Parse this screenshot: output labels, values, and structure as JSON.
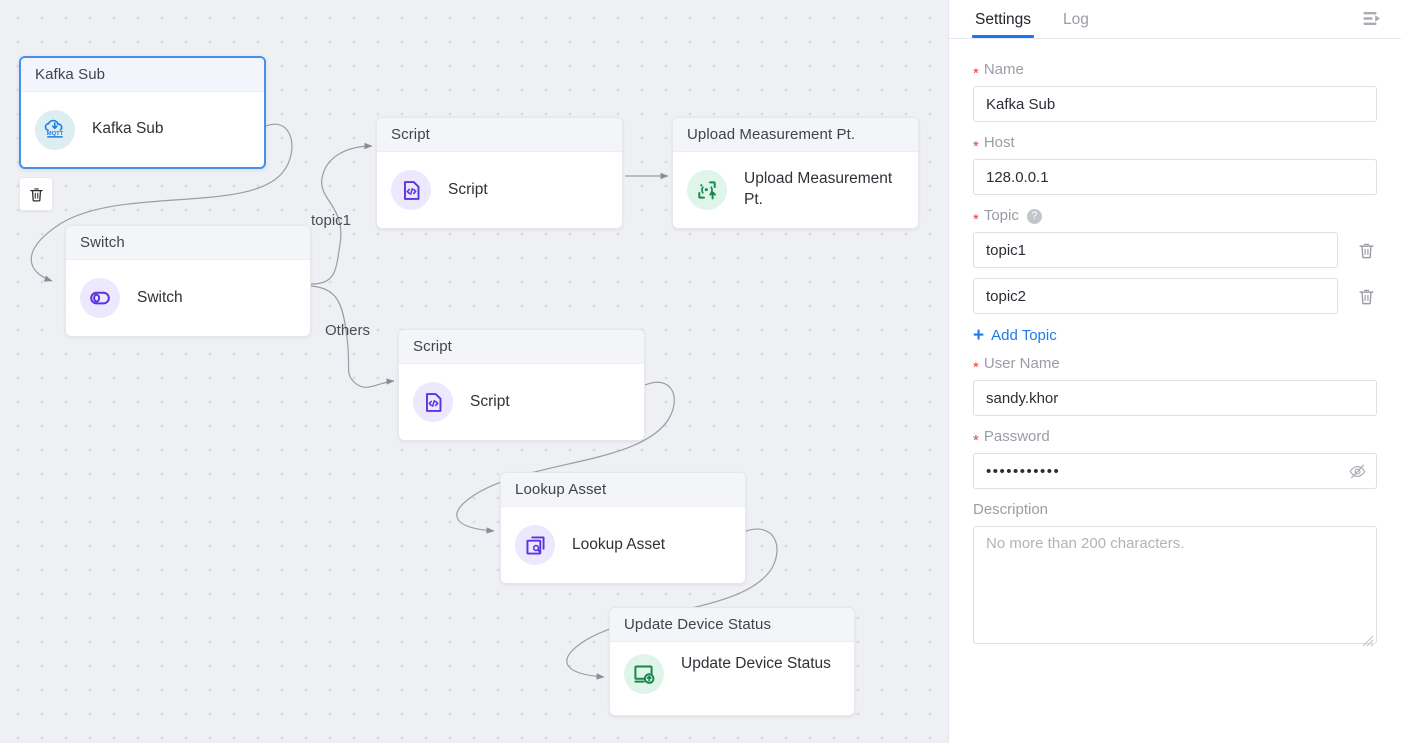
{
  "canvas": {
    "delete_button_icon": "trash-icon",
    "nodes": [
      {
        "id": "kafka-sub",
        "title": "Kafka Sub",
        "label": "Kafka Sub",
        "icon": "mqtt-cloud-icon",
        "selected": true
      },
      {
        "id": "switch",
        "title": "Switch",
        "label": "Switch",
        "icon": "switch-toggle-icon",
        "selected": false
      },
      {
        "id": "script-1",
        "title": "Script",
        "label": "Script",
        "icon": "script-code-icon",
        "selected": false
      },
      {
        "id": "upload-mp",
        "title": "Upload Measurement Pt.",
        "label": "Upload Measurement Pt.",
        "icon": "upload-signal-icon",
        "selected": false
      },
      {
        "id": "script-2",
        "title": "Script",
        "label": "Script",
        "icon": "script-code-icon",
        "selected": false
      },
      {
        "id": "lookup",
        "title": "Lookup Asset",
        "label": "Lookup Asset",
        "icon": "lookup-search-icon",
        "selected": false
      },
      {
        "id": "update-dev",
        "title": "Update Device Status",
        "label": "Update Device Status",
        "icon": "device-status-icon",
        "selected": false
      }
    ],
    "edge_labels": [
      {
        "id": "edge-topic1",
        "text": "topic1"
      },
      {
        "id": "edge-others",
        "text": "Others"
      }
    ]
  },
  "panel": {
    "tabs": [
      {
        "id": "settings",
        "label": "Settings",
        "active": true
      },
      {
        "id": "log",
        "label": "Log",
        "active": false
      }
    ],
    "collapse_icon": "collapse-panel-icon",
    "fields": {
      "name": {
        "label": "Name",
        "required": true,
        "value": "Kafka Sub"
      },
      "host": {
        "label": "Host",
        "required": true,
        "value": "128.0.0.1"
      },
      "topic": {
        "label": "Topic",
        "required": true,
        "help": "?",
        "values": [
          "topic1",
          "topic2"
        ],
        "delete_icon": "trash-icon",
        "add_label": "Add Topic",
        "add_icon": "plus-icon"
      },
      "user_name": {
        "label": "User Name",
        "required": true,
        "value": "sandy.khor"
      },
      "password": {
        "label": "Password",
        "required": true,
        "value": "•••••••••••",
        "toggle_icon": "eye-hidden-icon"
      },
      "description": {
        "label": "Description",
        "required": false,
        "value": "",
        "placeholder": "No more than 200 characters."
      }
    }
  },
  "colors": {
    "accent_blue": "#1976f0",
    "required_red": "#e8413c",
    "link_blue": "#1e7ae8",
    "node_selected_border": "#4a90e8",
    "canvas_bg": "#eff0f4",
    "icon_purple": "#5b33e0",
    "icon_green": "#18884f",
    "icon_mqtt_blue": "#1f7fe0"
  }
}
